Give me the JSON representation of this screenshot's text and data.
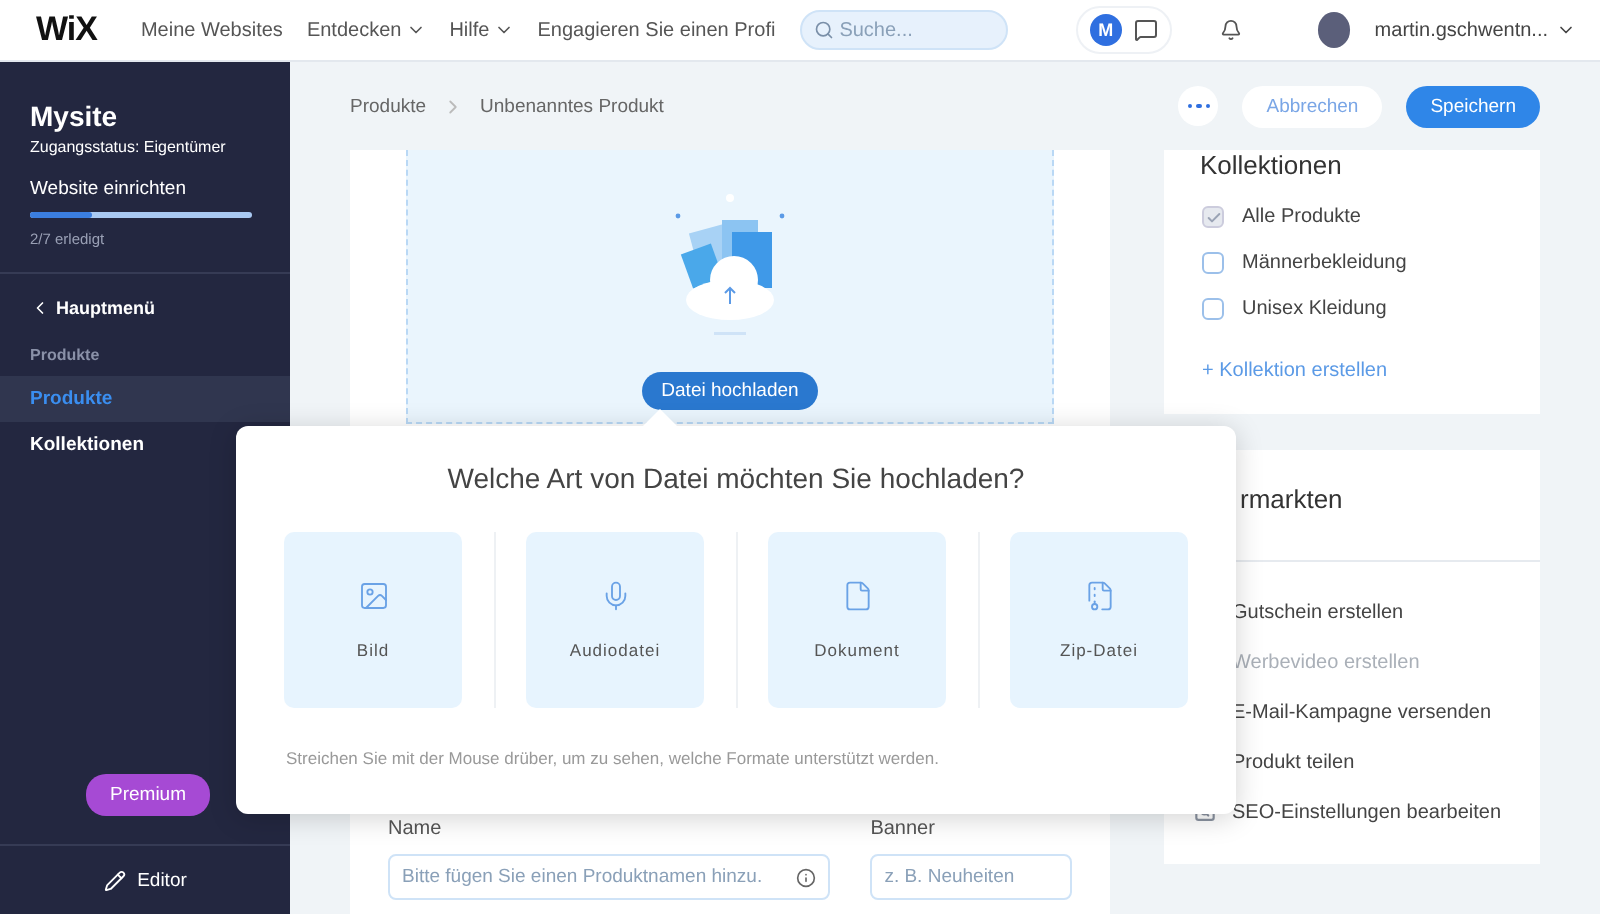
{
  "topbar": {
    "logo": "WiX",
    "nav": [
      {
        "label": "Meine Websites",
        "dropdown": false
      },
      {
        "label": "Entdecken",
        "dropdown": true
      },
      {
        "label": "Hilfe",
        "dropdown": true
      },
      {
        "label": "Engagieren Sie einen Profi",
        "dropdown": false
      }
    ],
    "search": {
      "placeholder": "Suche..."
    },
    "avatar_initial": "M",
    "user": "martin.gschwentn..."
  },
  "sidebar": {
    "site": "Mysite",
    "access": "Zugangsstatus: Eigentümer",
    "setup": {
      "title": "Website einrichten",
      "level": 0.28,
      "progress": "2/7 erledigt"
    },
    "back": "Hauptmenü",
    "section": "Produkte",
    "items": [
      {
        "label": "Produkte",
        "selected": true
      },
      {
        "label": "Kollektionen",
        "selected": false
      }
    ],
    "premium": "Premium",
    "editor": "Editor"
  },
  "breadcrumb": [
    "Produkte",
    "Unbenanntes Produkt"
  ],
  "actions": {
    "cancel": "Abbrechen",
    "save": "Speichern"
  },
  "upload": {
    "button": "Datei hochladen"
  },
  "form": {
    "fields": [
      {
        "label": "Name",
        "placeholder": "Bitte fügen Sie einen Produktnamen hinzu.",
        "warning": true
      },
      {
        "label": "Banner",
        "placeholder": "z. B. Neuheiten",
        "warning": false
      }
    ]
  },
  "collections": {
    "title": "Kollektionen",
    "items": [
      {
        "label": "Alle Produkte",
        "checked": true,
        "disabled": true
      },
      {
        "label": "Männerbekleidung",
        "checked": false,
        "disabled": false
      },
      {
        "label": "Unisex Kleidung",
        "checked": false,
        "disabled": false
      }
    ],
    "create": "+ Kollektion erstellen"
  },
  "marketing": {
    "title": "rmarkten",
    "items": [
      {
        "label": "Gutschein erstellen",
        "disabled": false
      },
      {
        "label": "Werbevideo erstellen",
        "disabled": true
      },
      {
        "label": "E-Mail-Kampagne versenden",
        "disabled": false
      },
      {
        "label": "Produkt teilen",
        "kind": "share",
        "disabled": false
      },
      {
        "label": "SEO-Einstellungen bearbeiten",
        "kind": "seo",
        "disabled": false
      }
    ]
  },
  "upload_popup": {
    "title": "Welche Art von Datei möchten Sie hochladen?",
    "options": [
      {
        "label": "Bild",
        "kind": "image"
      },
      {
        "label": "Audiodatei",
        "kind": "audio"
      },
      {
        "label": "Dokument",
        "kind": "document"
      },
      {
        "label": "Zip-Datei",
        "kind": "zip"
      }
    ],
    "hint": "Streichen Sie mit der Mouse drüber, um zu sehen, welche Formate unterstützt werden."
  }
}
